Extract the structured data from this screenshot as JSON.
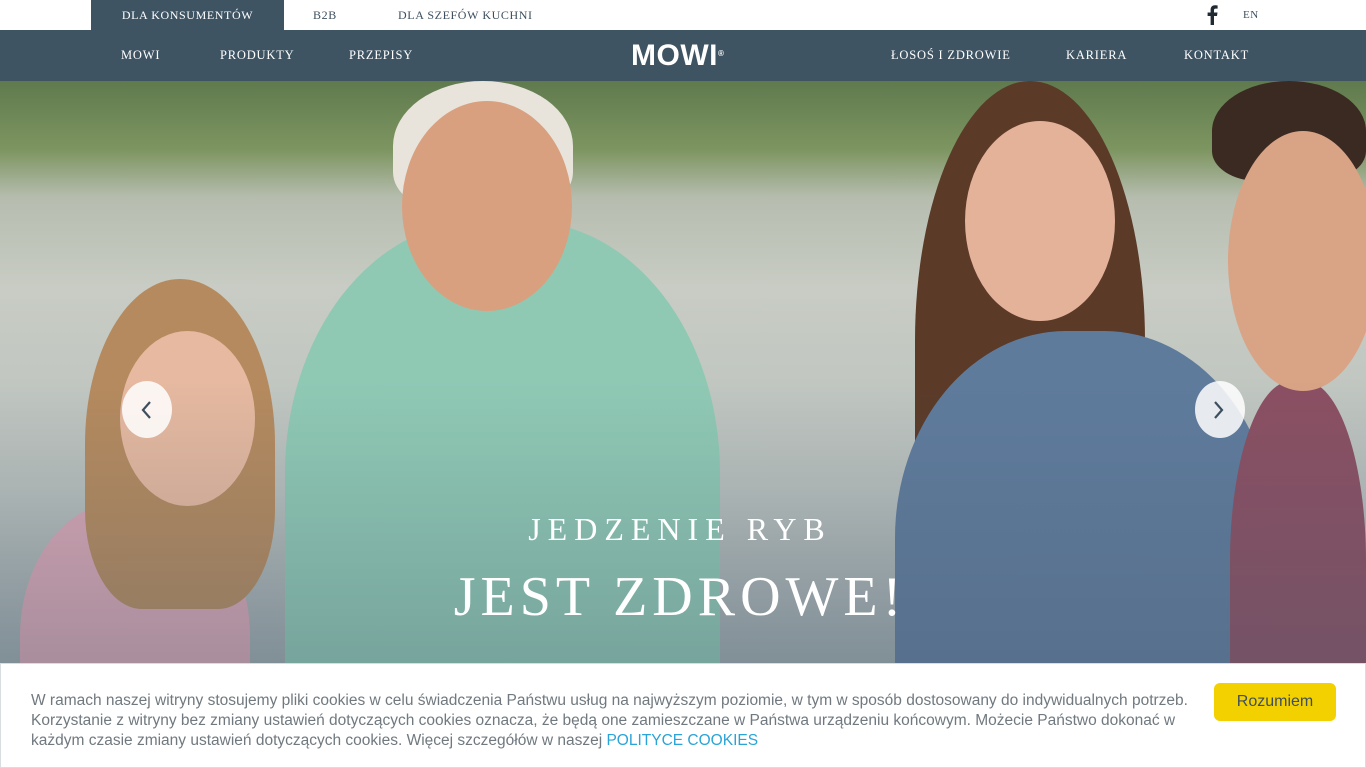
{
  "topbar": {
    "tabs": [
      {
        "label": "DLA KONSUMENTÓW",
        "active": true
      },
      {
        "label": "B2B",
        "active": false
      },
      {
        "label": "DLA SZEFÓW KUCHNI",
        "active": false
      }
    ],
    "social_icon": "facebook-icon",
    "language": "EN"
  },
  "nav": {
    "logo": "MOWI",
    "logo_mark": "®",
    "left_items": [
      "MOWI",
      "PRODUKTY",
      "PRZEPISY"
    ],
    "right_items": [
      "ŁOSOŚ I ZDROWIE",
      "KARIERA",
      "KONTAKT"
    ]
  },
  "hero": {
    "line1": "JEDZENIE RYB",
    "line2": "JEST ZDROWE!",
    "prev_icon": "chevron-left-icon",
    "next_icon": "chevron-right-icon"
  },
  "cookie": {
    "message": "W ramach naszej witryny stosujemy pliki cookies w celu świadczenia Państwu usług na najwyższym poziomie, w tym w sposób dostosowany do indywidualnych potrzeb. Korzystanie z witryny bez zmiany ustawień dotyczących cookies oznacza, że będą one zamieszczane w Państwa urządzeniu końcowym. Możecie Państwo dokonać w każdym czasie zmiany ustawień dotyczących cookies. Więcej szczegółów w naszej",
    "link": "Polityce Cookies",
    "button": "Rozumiem"
  },
  "colors": {
    "nav_bg": "#3f5463",
    "accent_button": "#f3d100",
    "link": "#2aa4d8"
  }
}
